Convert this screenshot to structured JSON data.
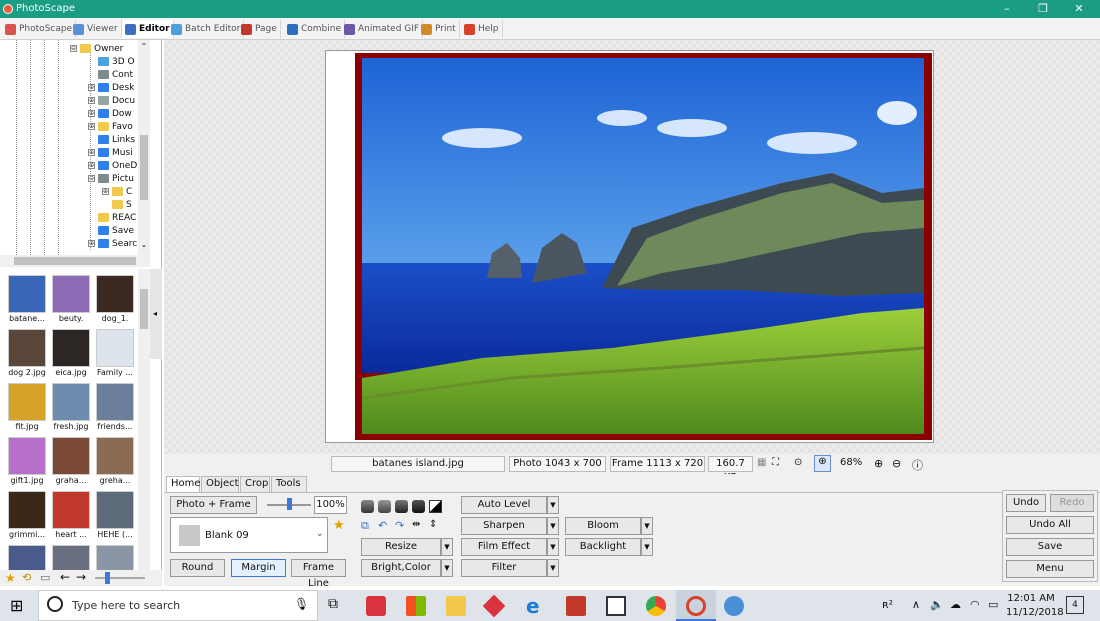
{
  "window": {
    "title": "PhotoScape",
    "controls": [
      "–",
      "❐",
      "✕"
    ]
  },
  "main_tabs": [
    {
      "label": "PhotoScape",
      "color": "#d9534f",
      "active": false
    },
    {
      "label": "Viewer",
      "color": "#5b8fd6",
      "active": false
    },
    {
      "label": "Editor",
      "color": "#3c6fc2",
      "active": true
    },
    {
      "label": "Batch Editor",
      "color": "#4aa0d8",
      "active": false
    },
    {
      "label": "Page",
      "color": "#c0392b",
      "active": false
    },
    {
      "label": "Combine",
      "color": "#2f6fbf",
      "active": false
    },
    {
      "label": "Animated GIF",
      "color": "#6c5aa8",
      "active": false
    },
    {
      "label": "Print",
      "color": "#d18b2a",
      "active": false
    },
    {
      "label": "Help",
      "color": "#d9412c",
      "active": false
    }
  ],
  "tree": {
    "items": [
      {
        "label": "Owner",
        "color": "#f2c94c",
        "expander": "⊖"
      },
      {
        "label": "3D O",
        "color": "#4aa3df",
        "expander": ""
      },
      {
        "label": "Cont",
        "color": "#7f8c8d",
        "expander": ""
      },
      {
        "label": "Desk",
        "color": "#2f80ed",
        "expander": "⊕"
      },
      {
        "label": "Docu",
        "color": "#95a5a6",
        "expander": "⊕"
      },
      {
        "label": "Dow",
        "color": "#2f80ed",
        "expander": "⊕"
      },
      {
        "label": "Favo",
        "color": "#f2c94c",
        "expander": "⊕"
      },
      {
        "label": "Links",
        "color": "#2f80ed",
        "expander": ""
      },
      {
        "label": "Musi",
        "color": "#2f80ed",
        "expander": "⊕"
      },
      {
        "label": "OneD",
        "color": "#2f80ed",
        "expander": "⊕"
      },
      {
        "label": "Pictu",
        "color": "#7f8c8d",
        "expander": "⊖"
      },
      {
        "label": "C",
        "color": "#f2c94c",
        "expander": "⊕"
      },
      {
        "label": "S",
        "color": "#f2c94c",
        "expander": ""
      },
      {
        "label": "REAC",
        "color": "#f2c94c",
        "expander": ""
      },
      {
        "label": "Save",
        "color": "#2f80ed",
        "expander": ""
      },
      {
        "label": "Searc",
        "color": "#2f80ed",
        "expander": "⊕"
      }
    ]
  },
  "thumbnails": [
    {
      "name": "batane...",
      "color": "#3a66b8"
    },
    {
      "name": "beuty.",
      "color": "#8e6bb5"
    },
    {
      "name": "dog_1.",
      "color": "#3b2a22"
    },
    {
      "name": "dog 2.jpg",
      "color": "#5a4638"
    },
    {
      "name": "eica.jpg",
      "color": "#2c2624"
    },
    {
      "name": "Family ...",
      "color": "#dde3ea"
    },
    {
      "name": "fit.jpg",
      "color": "#d7a22a"
    },
    {
      "name": "fresh.jpg",
      "color": "#6e8bb0"
    },
    {
      "name": "friends...",
      "color": "#6b7f9a"
    },
    {
      "name": "gift1.jpg",
      "color": "#b86fc9"
    },
    {
      "name": "graha...",
      "color": "#7a4a36"
    },
    {
      "name": "greha...",
      "color": "#8a6b54"
    },
    {
      "name": "grimmi...",
      "color": "#3b2818"
    },
    {
      "name": "heart ...",
      "color": "#c0392b"
    },
    {
      "name": "HEHE (...",
      "color": "#5c6a7a"
    },
    {
      "name": "",
      "color": "#4a5a8a"
    },
    {
      "name": "",
      "color": "#6a7080"
    },
    {
      "name": "",
      "color": "#8a96a6"
    }
  ],
  "status": {
    "filename": "batanes island.jpg",
    "photo_size": "Photo 1043 x 700",
    "frame_size": "Frame 1113 x 720",
    "file_size": "160.7 KB",
    "zoom": "68%"
  },
  "editor_tabs": [
    {
      "label": "Home",
      "active": true
    },
    {
      "label": "Object",
      "active": false
    },
    {
      "label": "Crop",
      "active": false
    },
    {
      "label": "Tools",
      "active": false
    }
  ],
  "home": {
    "photo_frame_button": "Photo + Frame",
    "frame_percent": "100%",
    "frame_percent_value": 1.0,
    "frame_select": "Blank 09",
    "round_button": "Round",
    "margin_button": "Margin",
    "frame_line_button": "Frame Line",
    "auto_level": "Auto Level",
    "sharpen": "Sharpen",
    "film_effect": "Film Effect",
    "filter": "Filter",
    "resize": "Resize",
    "bright_color": "Bright,Color",
    "bloom": "Bloom",
    "backlight": "Backlight",
    "undo": "Undo",
    "redo": "Redo",
    "undo_all": "Undo All",
    "save": "Save",
    "menu": "Menu",
    "dropdown_arrow": "▼"
  },
  "taskbar": {
    "search_placeholder": "Type here to search",
    "time": "12:01 AM",
    "date": "11/12/2018",
    "notifications": "4"
  }
}
